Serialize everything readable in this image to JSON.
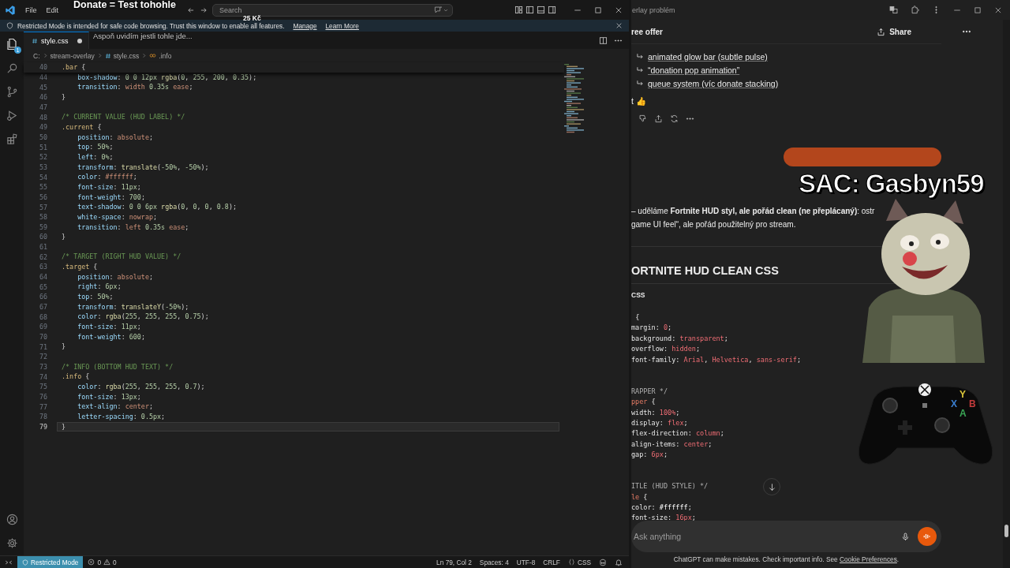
{
  "vscode": {
    "menu": [
      "File",
      "Edit"
    ],
    "search": {
      "placeholder": "Search"
    },
    "banner": {
      "text": "Restricted Mode is intended for safe code browsing. Trust this window to enable all features.",
      "links": [
        "Manage",
        "Learn More"
      ]
    },
    "activity_bar": {
      "explorer_badge": "1"
    },
    "tabs": [
      {
        "label": "style.css",
        "selected": true,
        "modified": true
      }
    ],
    "breadcrumbs": [
      "C:",
      "stream-overlay",
      "style.css",
      ".info"
    ],
    "editor": {
      "sticky": {
        "number": "40",
        "text": ".bar {"
      },
      "lines": [
        {
          "number": "44",
          "text": "    box-shadow: 0 0 12px rgba(0, 255, 200, 0.35);",
          "current": false
        },
        {
          "number": "45",
          "text": "    transition: width 0.35s ease;",
          "current": false
        },
        {
          "number": "46",
          "text": "}",
          "current": false
        },
        {
          "number": "47",
          "current": false
        },
        {
          "number": "48",
          "text": "/* CURRENT VALUE (HUD LABEL) */",
          "current": false
        },
        {
          "number": "49",
          "text": ".current {",
          "current": false
        },
        {
          "number": "50",
          "text": "    position: absolute;",
          "current": false
        },
        {
          "number": "51",
          "text": "    top: 50%;",
          "current": false
        },
        {
          "number": "52",
          "text": "    left: 0%;",
          "current": false
        },
        {
          "number": "53",
          "text": "    transform: translate(-50%, -50%);",
          "current": false
        },
        {
          "number": "54",
          "text": "    color: #ffffff;",
          "current": false
        },
        {
          "number": "55",
          "text": "    font-size: 11px;",
          "current": false
        },
        {
          "number": "56",
          "text": "    font-weight: 700;",
          "current": false
        },
        {
          "number": "57",
          "text": "    text-shadow: 0 0 6px rgba(0, 0, 0, 0.8);",
          "current": false
        },
        {
          "number": "58",
          "text": "    white-space: nowrap;",
          "current": false
        },
        {
          "number": "59",
          "text": "    transition: left 0.35s ease;",
          "current": false
        },
        {
          "number": "60",
          "text": "}",
          "current": false
        },
        {
          "number": "61",
          "current": false
        },
        {
          "number": "62",
          "text": "/* TARGET (RIGHT HUD VALUE) */",
          "current": false
        },
        {
          "number": "63",
          "text": ".target {",
          "current": false
        },
        {
          "number": "64",
          "text": "    position: absolute;",
          "current": false
        },
        {
          "number": "65",
          "text": "    right: 6px;",
          "current": false
        },
        {
          "number": "66",
          "text": "    top: 50%;",
          "current": false
        },
        {
          "number": "67",
          "text": "    transform: translateY(-50%);",
          "current": false
        },
        {
          "number": "68",
          "text": "    color: rgba(255, 255, 255, 0.75);",
          "current": false
        },
        {
          "number": "69",
          "text": "    font-size: 11px;",
          "current": false
        },
        {
          "number": "70",
          "text": "    font-weight: 600;",
          "current": false
        },
        {
          "number": "71",
          "text": "}",
          "current": false
        },
        {
          "number": "72",
          "current": false
        },
        {
          "number": "73",
          "text": "/* INFO (BOTTOM HUD TEXT) */",
          "current": false
        },
        {
          "number": "74",
          "text": ".info {",
          "current": false
        },
        {
          "number": "75",
          "text": "    color: rgba(255, 255, 255, 0.7);",
          "current": false
        },
        {
          "number": "76",
          "text": "    font-size: 13px;",
          "current": false
        },
        {
          "number": "77",
          "text": "    text-align: center;",
          "current": false
        },
        {
          "number": "78",
          "text": "    letter-spacing: 0.5px;",
          "current": false
        },
        {
          "number": "79",
          "text": "}",
          "current": true
        }
      ]
    },
    "status_bar": {
      "mode": "Restricted Mode",
      "errors": "0",
      "warnings": "0",
      "items": [
        "Ln 79, Col 2",
        "Spaces: 4",
        "UTF-8",
        "CRLF"
      ],
      "language": "CSS"
    }
  },
  "chat": {
    "window_title": "erlay problém",
    "header": {
      "title": "ree offer",
      "share": "Share"
    },
    "list": [
      "animated glow bar (subtle pulse)",
      "“donation pop animation”",
      "queue system (víc donate stacking)"
    ],
    "reaction": "t 👍",
    "paragraph": [
      "– uděláme **Fortnite HUD styl, ale pořád clean (ne přeplácaný)**: ostr",
      "game UI feel“, ale pořád použitelný pro stream."
    ],
    "heading": "ORTNITE HUD CLEAN CSS",
    "code_label": "CSS",
    "code_blocks": [
      [
        " {",
        "margin: 0;",
        "background: transparent;",
        "overflow: hidden;",
        "font-family: Arial, Helvetica, sans-serif;"
      ],
      [
        "RAPPER */",
        "pper {",
        "width: 100%;",
        "display: flex;",
        "flex-direction: column;",
        "align-items: center;",
        "gap: 6px;"
      ],
      [
        "ITLE (HUD STYLE) */",
        "le {",
        "color: #ffffff;",
        "font-size: 16px;"
      ]
    ],
    "input": {
      "placeholder": "Ask anything"
    },
    "footer": {
      "text": "ChatGPT can make mistakes. Check important info. See ",
      "link": "Cookie Preferences",
      "end": "."
    }
  },
  "overlay": {
    "donate_title": "Donate = Test tohohle",
    "amount": "25 Kč",
    "donate_message": "Aspoň uvidím jestli tohle jde...",
    "subscriber": "SAC: Gasbyn59",
    "controller_buttons": [
      {
        "label": "Y",
        "color": "#d9c53a"
      },
      {
        "label": "X",
        "color": "#3b7fd1"
      },
      {
        "label": "B",
        "color": "#c23b3b"
      },
      {
        "label": "A",
        "color": "#3aa655"
      }
    ]
  }
}
